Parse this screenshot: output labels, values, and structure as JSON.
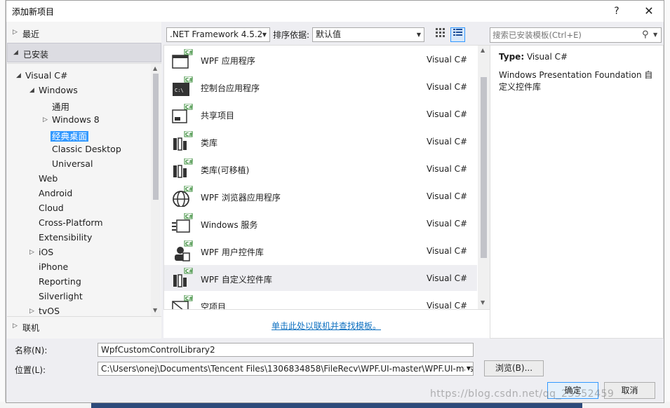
{
  "dialog": {
    "title": "添加新项目",
    "help": "?",
    "close": "✕"
  },
  "left": {
    "recent": "最近",
    "installed": "已安装",
    "online": "联机",
    "tree": [
      {
        "label": "Visual C#",
        "arrow": "◢"
      },
      {
        "label": "Windows",
        "arrow": "◢"
      },
      {
        "label": "通用",
        "arrow": ""
      },
      {
        "label": "Windows 8",
        "arrow": "▷"
      },
      {
        "label": "经典桌面",
        "arrow": ""
      },
      {
        "label": "Classic Desktop",
        "arrow": ""
      },
      {
        "label": "Universal",
        "arrow": ""
      },
      {
        "label": "Web",
        "arrow": ""
      },
      {
        "label": "Android",
        "arrow": ""
      },
      {
        "label": "Cloud",
        "arrow": ""
      },
      {
        "label": "Cross-Platform",
        "arrow": ""
      },
      {
        "label": "Extensibility",
        "arrow": ""
      },
      {
        "label": "iOS",
        "arrow": "▷"
      },
      {
        "label": "iPhone",
        "arrow": ""
      },
      {
        "label": "Reporting",
        "arrow": ""
      },
      {
        "label": "Silverlight",
        "arrow": ""
      },
      {
        "label": "tvOS",
        "arrow": "▷"
      }
    ]
  },
  "toolbar": {
    "framework": ".NET Framework 4.5.2",
    "sort_label": "排序依据:",
    "sort_value": "默认值"
  },
  "templates": [
    {
      "name": "WPF 应用程序",
      "lang": "Visual C#",
      "icon": "wpf-app-icon"
    },
    {
      "name": "控制台应用程序",
      "lang": "Visual C#",
      "icon": "console-app-icon"
    },
    {
      "name": "共享项目",
      "lang": "Visual C#",
      "icon": "shared-project-icon"
    },
    {
      "name": "类库",
      "lang": "Visual C#",
      "icon": "class-library-icon"
    },
    {
      "name": "类库(可移植)",
      "lang": "Visual C#",
      "icon": "portable-library-icon"
    },
    {
      "name": "WPF 浏览器应用程序",
      "lang": "Visual C#",
      "icon": "browser-app-icon"
    },
    {
      "name": "Windows 服务",
      "lang": "Visual C#",
      "icon": "windows-service-icon"
    },
    {
      "name": "WPF 用户控件库",
      "lang": "Visual C#",
      "icon": "user-control-library-icon"
    },
    {
      "name": "WPF 自定义控件库",
      "lang": "Visual C#",
      "icon": "custom-control-library-icon"
    },
    {
      "name": "空项目",
      "lang": "Visual C#",
      "icon": "empty-project-icon"
    }
  ],
  "online_link": "单击此处以联机并查找模板。",
  "search": {
    "placeholder": "搜索已安装模板(Ctrl+E)"
  },
  "details": {
    "type_label": "Type:",
    "type_value": "Visual C#",
    "description": "Windows Presentation Foundation 自定义控件库"
  },
  "form": {
    "name_label": "名称(N):",
    "name_value": "WpfCustomControlLibrary2",
    "location_label": "位置(L):",
    "location_value": "C:\\Users\\onej\\Documents\\Tencent Files\\1306834858\\FileRecv\\WPF.UI-master\\WPF.UI-mas",
    "browse": "浏览(B)...",
    "ok": "确定",
    "cancel": "取消"
  },
  "watermark": "https://blog.csdn.net/qq_23352459",
  "colors": {
    "accent": "#3399ff",
    "link": "#0e70c0",
    "dialog_bg": "#eeeef2"
  }
}
